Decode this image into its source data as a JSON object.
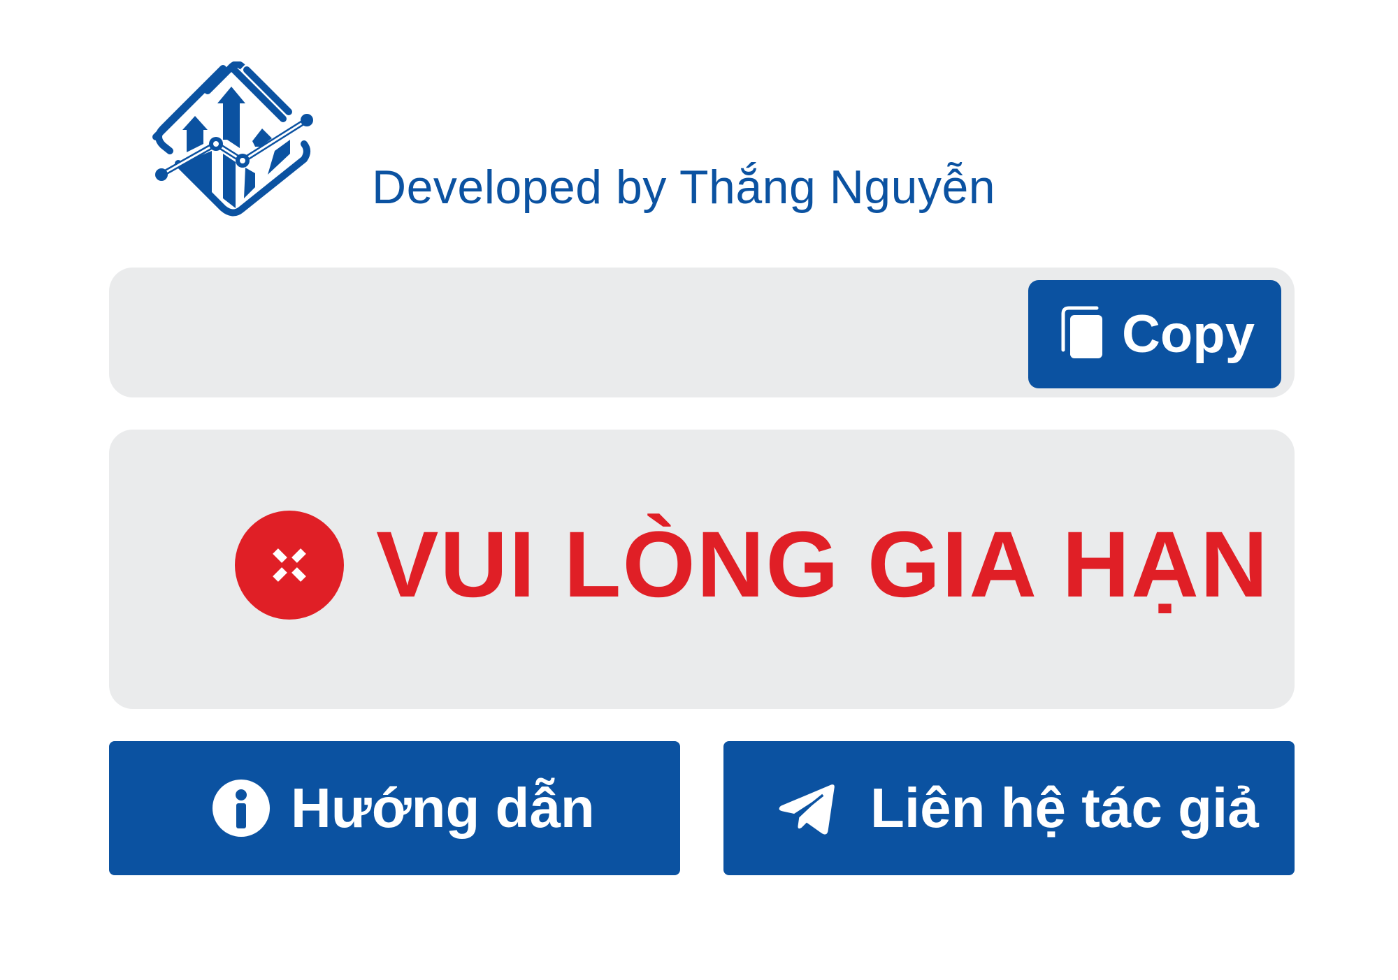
{
  "header": {
    "credit": "Developed by Thắng Nguyễn",
    "logo_icon": "stock-chart-diamond-logo"
  },
  "key_bar": {
    "value": "",
    "copy_label": "Copy",
    "copy_icon": "copy-icon"
  },
  "status": {
    "message": "VUI LÒNG GIA HẠN",
    "icon": "error-x-circle-icon"
  },
  "actions": {
    "guide_label": "Hướng dẫn",
    "guide_icon": "info-icon",
    "contact_label": "Liên hệ tác giả",
    "contact_icon": "telegram-send-icon"
  },
  "colors": {
    "brand_blue": "#0b52a1",
    "error_red": "#e01f26",
    "panel_gray": "#eaebec"
  }
}
